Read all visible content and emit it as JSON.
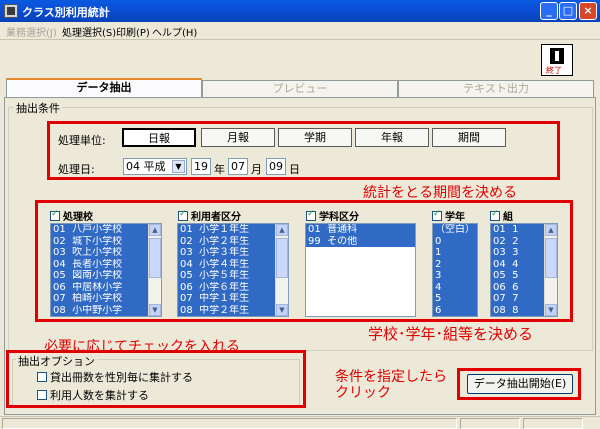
{
  "window": {
    "title": "クラス別利用統計",
    "minimize": "_",
    "maximize": "□",
    "close": "×"
  },
  "menu": {
    "items": [
      {
        "label": "業務選択(J)",
        "disabled": true
      },
      {
        "label": "処理選択(S)",
        "disabled": false
      },
      {
        "label": "印刷(P)",
        "disabled": false
      },
      {
        "label": "ヘルプ(H)",
        "disabled": false
      }
    ]
  },
  "exit_button": {
    "label": "終了"
  },
  "tabs": [
    {
      "label": "データ抽出",
      "active": true
    },
    {
      "label": "プレビュー",
      "active": false
    },
    {
      "label": "テキスト出力",
      "active": false
    }
  ],
  "conditions": {
    "group_label": "抽出条件",
    "unit_label": "処理単位:",
    "units": [
      "日報",
      "月報",
      "学期",
      "年報",
      "期間"
    ],
    "selected_unit": "日報",
    "date_label": "処理日:",
    "era": "04 平成",
    "year": "19",
    "year_suffix": "年",
    "month": "07",
    "month_suffix": "月",
    "day": "09",
    "day_suffix": "日"
  },
  "annotations": {
    "period": "統計をとる期間を決める",
    "school": "学校･学年･組等を決める",
    "check": "必要に応じてチェックを入れる",
    "click_line1": "条件を指定したら",
    "click_line2": "クリック"
  },
  "lists": {
    "school": {
      "label": "処理校",
      "checked": true,
      "items": [
        "01  八戸小学校",
        "02  城下小学校",
        "03  吹上小学校",
        "04  長者小学校",
        "05  図南小学校",
        "06  中居林小学",
        "07  柏崎小学校",
        "08  小中野小学"
      ]
    },
    "user": {
      "label": "利用者区分",
      "checked": true,
      "items": [
        "01  小学１年生",
        "02  小学２年生",
        "03  小学３年生",
        "04  小学４年生",
        "05  小学５年生",
        "06  小学６年生",
        "07  中学１年生",
        "08  中学２年生"
      ]
    },
    "dept": {
      "label": "学科区分",
      "checked": true,
      "items": [
        "01  普通科",
        "99  その他"
      ]
    },
    "grade": {
      "label": "学年",
      "checked": true,
      "items": [
        "（空白）",
        "0",
        "1",
        "2",
        "3",
        "4",
        "5",
        "6"
      ]
    },
    "class": {
      "label": "組",
      "checked": true,
      "items": [
        "01  1",
        "02  2",
        "03  3",
        "04  4",
        "05  5",
        "06  6",
        "07  7",
        "08  8"
      ]
    }
  },
  "options": {
    "group_label": "抽出オプション",
    "items": [
      {
        "label": "貸出冊数を性別毎に集計する",
        "checked": false
      },
      {
        "label": "利用人数を集計する",
        "checked": false
      }
    ]
  },
  "extract_button": {
    "label": "データ抽出開始(E)"
  },
  "colors": {
    "annotation_red": "#e00000",
    "selection_blue": "#316ac5",
    "title_blue": "#0a4fd6"
  },
  "icons": {
    "exit": "running-man-exit-icon",
    "dropdown": "chevron-down-icon",
    "scroll_up": "chevron-up-icon",
    "scroll_down": "chevron-down-icon"
  }
}
